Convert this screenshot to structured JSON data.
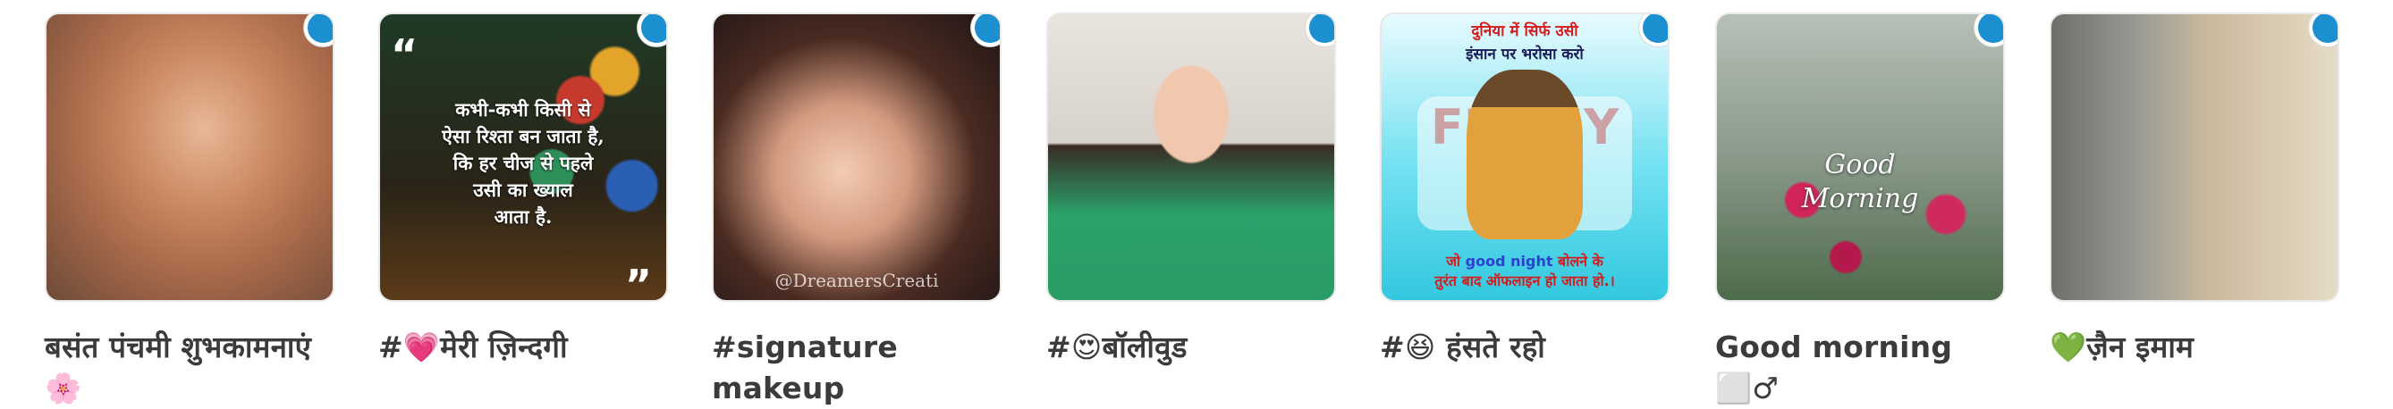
{
  "cards": [
    {
      "label": "बसंत पंचमी शुभकामनाएं🌸"
    },
    {
      "label": "#💗मेरी ज़िन्दगी",
      "overlay": {
        "open_quote": "“",
        "close_quote": "”",
        "lines": [
          "कभी-कभी किसी से",
          "ऐसा रिश्ता बन जाता है,",
          "कि हर चीज से पहले",
          "उसी का ख्याल",
          "आता है."
        ]
      }
    },
    {
      "label": "#signature makeup",
      "overlay": {
        "watermark": "@DreamersCreati"
      }
    },
    {
      "label": "#😍बॉलीवुड"
    },
    {
      "label": "#😆 हंसते रहो",
      "overlay": {
        "top_line1": "दुनिया में सिर्फ उसी",
        "top_line2": "इंसान पर भरोसा करो",
        "bg_text": "FUNNY LIFE",
        "bottom_line1_pre": "जो ",
        "bottom_line1_mid": "good night",
        "bottom_line1_post": " बोलने के",
        "bottom_line2": "तुरंत बाद ऑफलाइन हो जाता हो.।"
      }
    },
    {
      "label": "Good morning ⬜♂",
      "overlay": {
        "line1": "Good",
        "line2": "Morning"
      }
    },
    {
      "label": "💚ज़ैन इमाम"
    }
  ],
  "colors": {
    "badge": "#1b8fd0",
    "label_text": "#3b3b3b"
  }
}
